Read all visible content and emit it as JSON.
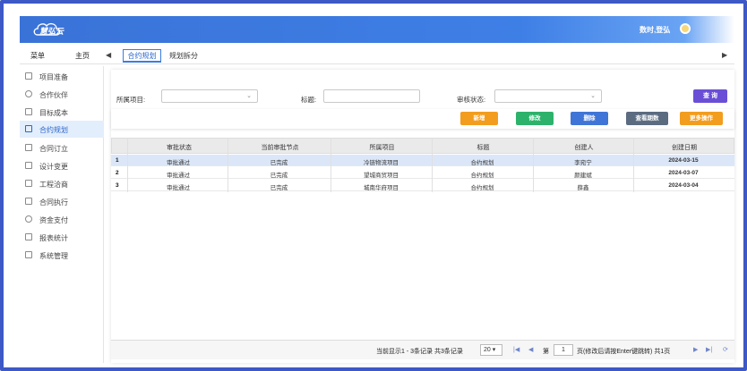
{
  "app": {
    "logo_text": "慧弘云",
    "user_name": "数时,登弘"
  },
  "tabs": {
    "menu": "菜单",
    "home": "主页",
    "active": "合约规划",
    "other": "规划拆分"
  },
  "sidebar": {
    "items": [
      {
        "label": "项目准备"
      },
      {
        "label": "合作伙伴"
      },
      {
        "label": "目标成本"
      },
      {
        "label": "合约规划"
      },
      {
        "label": "合同订立"
      },
      {
        "label": "设计变更"
      },
      {
        "label": "工程洽商"
      },
      {
        "label": "合同执行"
      },
      {
        "label": "资金支付"
      },
      {
        "label": "报表统计"
      },
      {
        "label": "系统管理"
      }
    ],
    "active_index": 3
  },
  "filters": {
    "project_label": "所属项目:",
    "title_label": "标题:",
    "status_label": "审核状态:",
    "query_button": "查 询"
  },
  "toolbar": {
    "add": "新增",
    "edit": "修改",
    "delete": "删除",
    "view_flow": "查看期数",
    "more": "更多操作"
  },
  "colors": {
    "brand": "#3c59c6",
    "add": "#f29d1e",
    "edit": "#2db26b",
    "delete": "#3f75d6",
    "view_flow": "#5b6b80",
    "more": "#f29d1e",
    "query": "#6a4fd6"
  },
  "table": {
    "headers": [
      "审批状态",
      "当前审批节点",
      "所属项目",
      "标题",
      "创建人",
      "创建日期"
    ],
    "rows": [
      {
        "no": "1",
        "cells": [
          "审批通过",
          "已完成",
          "冷链物流项目",
          "合约规划",
          "李宛宁",
          "2024-03-15"
        ]
      },
      {
        "no": "2",
        "cells": [
          "审批通过",
          "已完成",
          "望城商贸项目",
          "合约规划",
          "颜建斌",
          "2024-03-07"
        ]
      },
      {
        "no": "3",
        "cells": [
          "审批通过",
          "已完成",
          "城南华府项目",
          "合约规划",
          "薛鑫",
          "2024-03-04"
        ]
      }
    ]
  },
  "pager": {
    "summary": "当前显示1 - 3条记录 共3条记录",
    "page_size": "20",
    "page_prefix": "第",
    "page_number": "1",
    "page_suffix": "页(修改后请按Enter键跳转) 共1页"
  }
}
